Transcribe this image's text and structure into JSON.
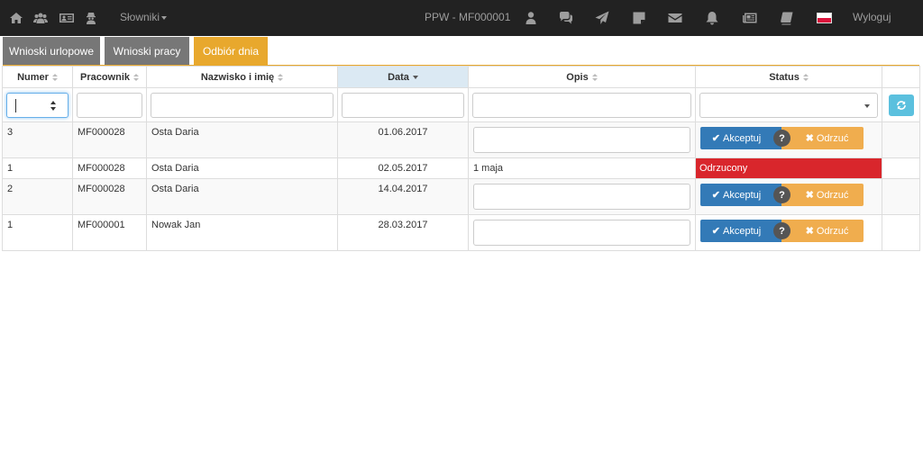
{
  "nav": {
    "dict_label": "Słowniki",
    "user_label": "PPW - MF000001",
    "logout_label": "Wyloguj"
  },
  "tabs": [
    {
      "label": "Wnioski urlopowe"
    },
    {
      "label": "Wnioski pracy"
    },
    {
      "label": "Odbiór dnia"
    }
  ],
  "colors": {
    "active_tab": "#e8a82d",
    "accept": "#337ab7",
    "reject": "#f0ad4e",
    "rejected_status": "#d9262c"
  },
  "table": {
    "headers": [
      "Numer",
      "Pracownik",
      "Nazwisko i imię",
      "Data",
      "Opis",
      "Status"
    ],
    "rows": [
      {
        "numer": "3",
        "pracownik": "MF000028",
        "nazwisko": "Osta Daria",
        "data": "01.06.2017",
        "opis": "",
        "status": "actions"
      },
      {
        "numer": "1",
        "pracownik": "MF000028",
        "nazwisko": "Osta Daria",
        "data": "02.05.2017",
        "opis": "1 maja",
        "status": "Odrzucony"
      },
      {
        "numer": "2",
        "pracownik": "MF000028",
        "nazwisko": "Osta Daria",
        "data": "14.04.2017",
        "opis": "",
        "status": "actions"
      },
      {
        "numer": "1",
        "pracownik": "MF000001",
        "nazwisko": "Nowak Jan",
        "data": "28.03.2017",
        "opis": "",
        "status": "actions"
      }
    ]
  },
  "actions": {
    "accept_label": "Akceptuj",
    "reject_label": "Odrzuć",
    "help_label": "?"
  }
}
